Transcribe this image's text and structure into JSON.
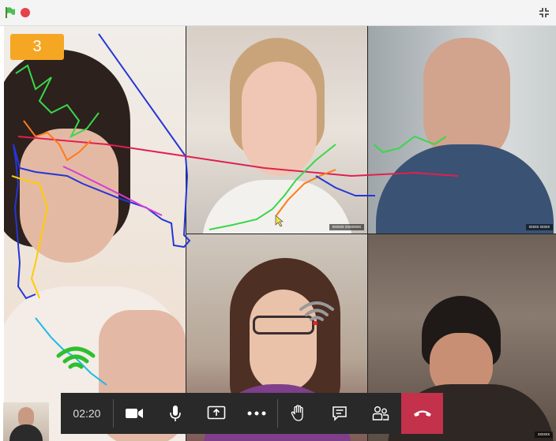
{
  "window": {
    "flag_icon": "green-flag-icon",
    "stop_icon": "stop-icon",
    "fullscreen_icon": "fullscreen-icon"
  },
  "score": "3",
  "participants": [
    {
      "tile": "large-left",
      "name_tag": ""
    },
    {
      "tile": "top-middle",
      "name_tag": "xxxxxx xxxxxxxx"
    },
    {
      "tile": "top-right",
      "name_tag": "xxxxx xxxxx"
    },
    {
      "tile": "bottom-middle",
      "name_tag": ""
    },
    {
      "tile": "bottom-right",
      "name_tag": "xxxxxx"
    }
  ],
  "call_controls": {
    "timer": "02:20",
    "buttons": [
      "camera-icon",
      "microphone-icon",
      "share-screen-icon",
      "more-options-icon",
      "raise-hand-icon",
      "chat-icon",
      "participants-icon",
      "hang-up-icon"
    ]
  },
  "colors": {
    "score_badge": "#f5a623",
    "hangup": "#c4314b",
    "callbar": "#292929",
    "wifi_good": "#2dbf2d"
  }
}
